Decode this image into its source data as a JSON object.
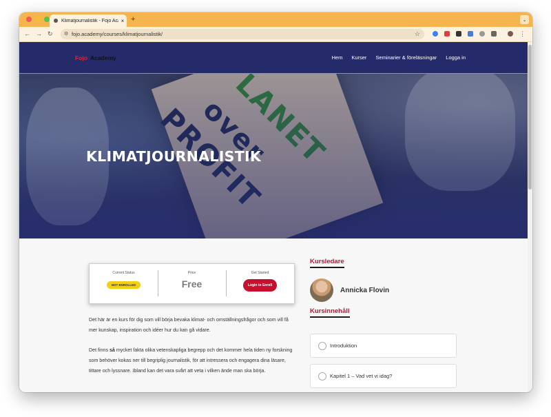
{
  "browser": {
    "tab_title": "Klimatjournalistik - Fojo Academy",
    "url": "fojo.academy/courses/klimatjournalistik/"
  },
  "site": {
    "logo_part1": "Fojo",
    "logo_part2": "Academy",
    "menu": [
      "Hem",
      "Kurser",
      "Seminarier & föreläsningar",
      "Logga in"
    ]
  },
  "hero": {
    "title": "KLIMATJOURNALISTIK",
    "sign_words": [
      "LANET",
      "over",
      "PROFIT"
    ]
  },
  "status_box": {
    "current_status_label": "Current Status",
    "status_badge": "NOT ENROLLED",
    "price_label": "Price",
    "price": "Free",
    "get_started_label": "Get Started",
    "button": "Login to Enroll"
  },
  "description": {
    "p1": "Det här är en kurs för dig som vill börja bevaka klimat- och omställningsfrågor och som vill få mer kunskap, inspiration och idéer hur du kan gå vidare.",
    "p2_before": "Det finns ",
    "p2_bold": "så",
    "p2_after": " mycket fakta olika vetenskapliga begrepp och det kommer hela tiden ny forskning som behöver kokas ner till begriplig journalistik, för att intressera och engagera dina läsare, tittare och lyssnare. Ibland kan det vara svårt att veta i vilken ände man ska börja."
  },
  "sidebar": {
    "teacher_heading": "Kursledare",
    "teacher_name": "Annicka Flovin",
    "content_heading": "Kursinnehåll",
    "lessons": [
      "Introduktion",
      "Kapitel 1 – Vad vet vi idag?"
    ]
  }
}
